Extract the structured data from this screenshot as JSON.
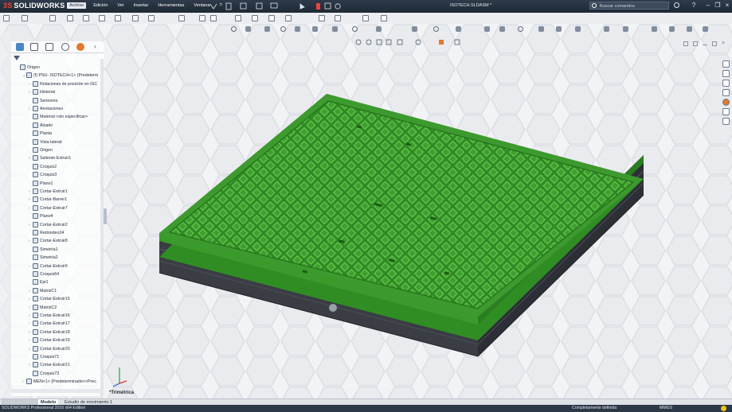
{
  "app": {
    "brand_prefix": "3S",
    "brand": "SOLIDWORKS",
    "document_title": "ISOTECH.SLDASM *"
  },
  "menu": [
    "Archivo",
    "Edición",
    "Ver",
    "Insertar",
    "Herramientas",
    "Ventana",
    "?"
  ],
  "search": {
    "placeholder": "Buscar comandos"
  },
  "tree": {
    "rows": [
      {
        "label": "Origen",
        "indent": 0,
        "icon": "origin-icon"
      },
      {
        "label": "(f) PSU- ISOTECH<1> (Predeterm",
        "indent": 1,
        "icon": "part-icon",
        "expander": "-"
      },
      {
        "label": "Relaciones de posición en ISC",
        "indent": 2,
        "icon": "mates-icon",
        "expander": ">"
      },
      {
        "label": "Historial",
        "indent": 2,
        "icon": "history-icon",
        "expander": ">"
      },
      {
        "label": "Sensores",
        "indent": 2,
        "icon": "sensor-icon"
      },
      {
        "label": "Anotaciones",
        "indent": 2,
        "icon": "annotation-icon",
        "expander": ">"
      },
      {
        "label": "Material <sin especificar>",
        "indent": 2,
        "icon": "material-icon"
      },
      {
        "label": "Alzado",
        "indent": 2,
        "icon": "plane-icon"
      },
      {
        "label": "Planta",
        "indent": 2,
        "icon": "plane-icon"
      },
      {
        "label": "Vista lateral",
        "indent": 2,
        "icon": "plane-icon"
      },
      {
        "label": "Origen",
        "indent": 2,
        "icon": "origin-icon"
      },
      {
        "label": "Saliente-Extruir1",
        "indent": 2,
        "icon": "extrude-icon",
        "expander": ">"
      },
      {
        "label": "Croquis2",
        "indent": 2,
        "icon": "sketch-icon"
      },
      {
        "label": "Croquis3",
        "indent": 2,
        "icon": "sketch-icon"
      },
      {
        "label": "Plano1",
        "indent": 2,
        "icon": "plane-icon"
      },
      {
        "label": "Cortar-Extruir1",
        "indent": 2,
        "icon": "cut-icon",
        "expander": ">"
      },
      {
        "label": "Cortar-Barrer1",
        "indent": 2,
        "icon": "sweep-icon",
        "expander": ">"
      },
      {
        "label": "Cortar-Extruir7",
        "indent": 2,
        "icon": "cut-icon",
        "expander": ">"
      },
      {
        "label": "Plano4",
        "indent": 2,
        "icon": "plane-icon"
      },
      {
        "label": "Cortar-Extruir2",
        "indent": 2,
        "icon": "cut-icon",
        "expander": ">"
      },
      {
        "label": "Redondeo24",
        "indent": 2,
        "icon": "fillet-icon"
      },
      {
        "label": "Cortar-Extruir8",
        "indent": 2,
        "icon": "cut-icon",
        "expander": ">"
      },
      {
        "label": "Simetría1",
        "indent": 2,
        "icon": "mirror-icon"
      },
      {
        "label": "Simetría2",
        "indent": 2,
        "icon": "mirror-icon"
      },
      {
        "label": "Cortar-Extruir9",
        "indent": 2,
        "icon": "cut-icon",
        "expander": ">"
      },
      {
        "label": "Croquis64",
        "indent": 2,
        "icon": "sketch-icon"
      },
      {
        "label": "Eje1",
        "indent": 2,
        "icon": "axis-icon"
      },
      {
        "label": "MatrizC1",
        "indent": 2,
        "icon": "pattern-icon",
        "expander": ">"
      },
      {
        "label": "Cortar-Extruir15",
        "indent": 2,
        "icon": "cut-icon",
        "expander": ">"
      },
      {
        "label": "MatrizC2",
        "indent": 2,
        "icon": "pattern-icon",
        "expander": ">"
      },
      {
        "label": "Cortar-Extruir16",
        "indent": 2,
        "icon": "cut-icon",
        "expander": ">"
      },
      {
        "label": "Cortar-Extruir17",
        "indent": 2,
        "icon": "cut-icon",
        "expander": ">"
      },
      {
        "label": "Cortar-Extruir18",
        "indent": 2,
        "icon": "cut-icon",
        "expander": ">"
      },
      {
        "label": "Cortar-Extruir19",
        "indent": 2,
        "icon": "cut-icon",
        "expander": ">"
      },
      {
        "label": "Cortar-Extruir20",
        "indent": 2,
        "icon": "cut-icon",
        "expander": ">"
      },
      {
        "label": "Croquis71",
        "indent": 2,
        "icon": "sketch-icon"
      },
      {
        "label": "Cortar-Extruir21",
        "indent": 2,
        "icon": "cut-icon",
        "expander": ">"
      },
      {
        "label": "Croquis73",
        "indent": 2,
        "icon": "sketch-icon"
      },
      {
        "label": "MEN<1> (Predeterminado<<Prec",
        "indent": 1,
        "icon": "part-icon",
        "expander": ">"
      }
    ]
  },
  "viewport": {
    "view_name": "*Trimétrica"
  },
  "tabs": [
    "Modelo",
    "Estudio de movimiento 1"
  ],
  "status": {
    "edition": "SOLIDWORKS Professional 2016 x64 Edition",
    "state": "Completamente definida",
    "units": "MMGS"
  },
  "colors": {
    "model_green": "#3d9a2e",
    "model_dark": "#3a3d44",
    "titlebar": "#26313f"
  }
}
